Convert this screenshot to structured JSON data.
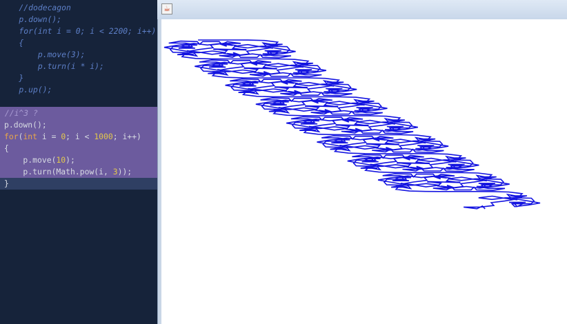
{
  "editor": {
    "lines_dim": [
      "    //dodecagon",
      "    p.down();",
      "    for(int i = 0; i < 2200; i++)",
      "    {",
      "        p.move(3);",
      "        p.turn(i * i);",
      "    }",
      "    p.up();"
    ],
    "comment_line": " //i^3 ?",
    "selected": {
      "line1": "p.down();",
      "line2_kw": "for",
      "line2_a": "(",
      "line2_int": "int",
      "line2_b": " i = ",
      "line2_zero": "0",
      "line2_c": "; i < ",
      "line2_num": "1000",
      "line2_d": "; i++)",
      "line3": "{",
      "line4_a": "    p.move(",
      "line4_num": "10",
      "line4_b": ");",
      "line5_a": "    p.turn(Math.pow(i, ",
      "line5_num": "3",
      "line5_b": "));",
      "line6": "}"
    }
  },
  "window": {
    "icon": "java-app-icon",
    "icon_glyph": "☕"
  },
  "drawing": {
    "stroke_color": "#1414e0",
    "background": "#ffffff"
  }
}
